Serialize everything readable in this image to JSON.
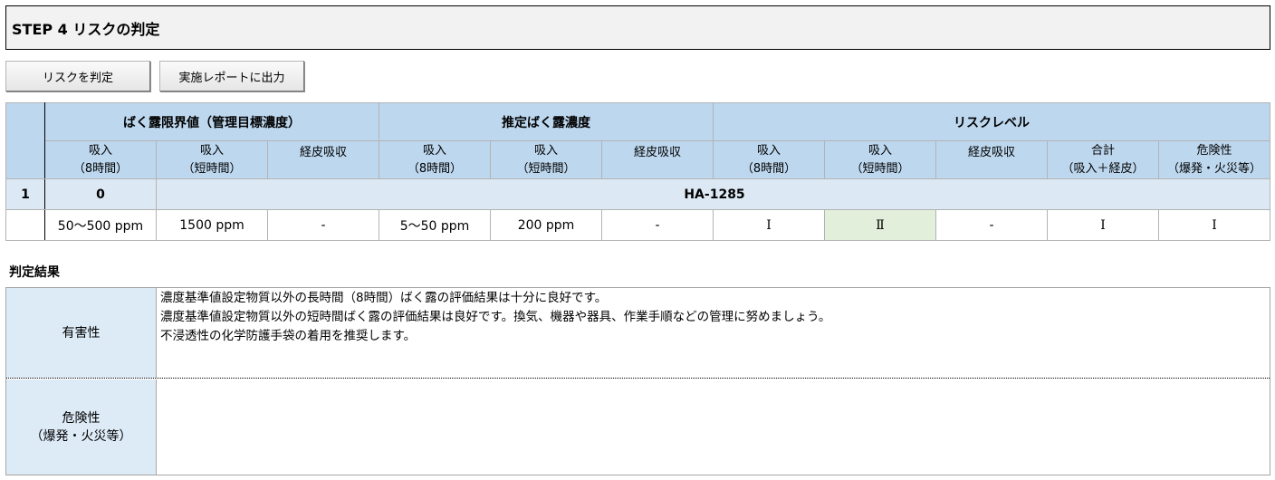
{
  "header": {
    "title": "STEP 4 リスクの判定"
  },
  "toolbar": {
    "judge_label": "リスクを判定",
    "report_label": "実施レポートに出力"
  },
  "table": {
    "groups": [
      "ばく露限界値（管理目標濃度）",
      "推定ばく露濃度",
      "リスクレベル"
    ],
    "subheaders": [
      {
        "line1": "吸入",
        "line2": "（8時間）"
      },
      {
        "line1": "吸入",
        "line2": "（短時間）"
      },
      {
        "line1": "経皮吸収",
        "line2": ""
      },
      {
        "line1": "吸入",
        "line2": "（8時間）"
      },
      {
        "line1": "吸入",
        "line2": "（短時間）"
      },
      {
        "line1": "経皮吸収",
        "line2": ""
      },
      {
        "line1": "吸入",
        "line2": "（8時間）"
      },
      {
        "line1": "吸入",
        "line2": "（短時間）"
      },
      {
        "line1": "経皮吸収",
        "line2": ""
      },
      {
        "line1": "合計",
        "line2": "（吸入＋経皮）"
      },
      {
        "line1": "危険性",
        "line2": "（爆発・火災等）"
      }
    ],
    "row": {
      "index": "1",
      "zero": "0",
      "code": "HA-1285",
      "values": [
        "50～500 ppm",
        "1500 ppm",
        "-",
        "5～50 ppm",
        "200 ppm",
        "-",
        "Ⅰ",
        "Ⅱ",
        "-",
        "Ⅰ",
        "Ⅰ"
      ]
    }
  },
  "result": {
    "label": "判定結果",
    "harm": {
      "head": "有害性",
      "lines": [
        "濃度基準値設定物質以外の長時間（8時間）ばく露の評価結果は十分に良好です。",
        "濃度基準値設定物質以外の短時間ばく露の評価結果は良好です。換気、機器や器具、作業手順などの管理に努めましょう。",
        "不浸透性の化学防護手袋の着用を推奨します。"
      ]
    },
    "danger": {
      "head_line1": "危険性",
      "head_line2": "（爆発・火災等）"
    }
  }
}
